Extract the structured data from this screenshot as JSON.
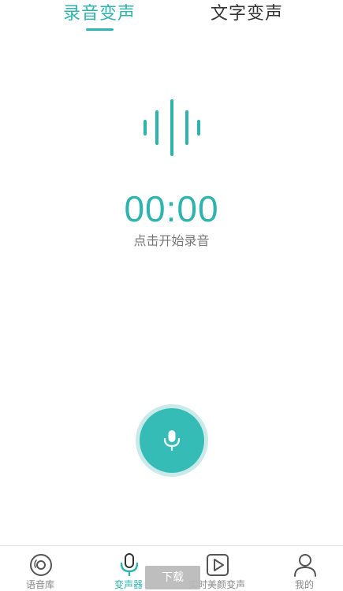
{
  "tabs": {
    "record": "录音变声",
    "text": "文字变声",
    "active": "record"
  },
  "timer": {
    "value": "00:00",
    "hint": "点击开始录音"
  },
  "icons": {
    "waveform": "waveform-icon",
    "record": "microphone-icon"
  },
  "nav": {
    "items": [
      {
        "label": "语音库",
        "icon": "disc-icon",
        "active": false
      },
      {
        "label": "变声器",
        "icon": "microphone-icon",
        "active": true
      },
      {
        "label": "实时美颜变声",
        "icon": "play-icon",
        "active": false
      },
      {
        "label": "我的",
        "icon": "user-icon",
        "active": false
      }
    ]
  },
  "overlay": {
    "download_label": "下载"
  },
  "colors": {
    "accent": "#2fb3ae",
    "accent_light": "#c9eae8",
    "text_dark": "#333333",
    "text_muted": "#888888"
  }
}
